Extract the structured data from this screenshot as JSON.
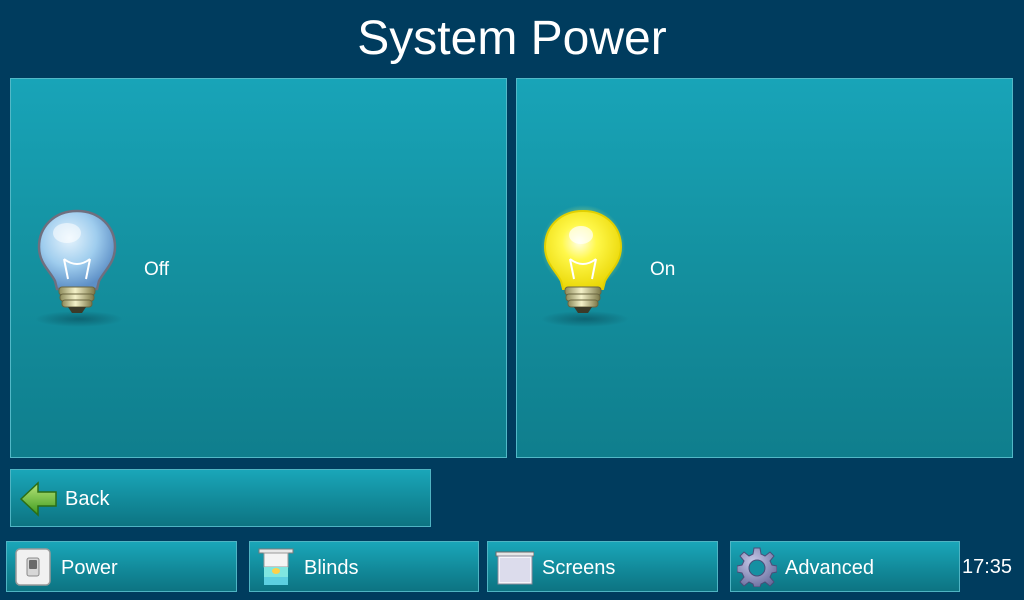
{
  "header": {
    "title": "System Power"
  },
  "panels": [
    {
      "label": "Off",
      "icon": "lightbulb-off-icon",
      "state": "off"
    },
    {
      "label": "On",
      "icon": "lightbulb-on-icon",
      "state": "on"
    }
  ],
  "back": {
    "label": "Back",
    "icon": "back-arrow-icon"
  },
  "nav": {
    "items": [
      {
        "label": "Power",
        "icon": "power-switch-icon"
      },
      {
        "label": "Blinds",
        "icon": "blinds-icon"
      },
      {
        "label": "Screens",
        "icon": "projector-screen-icon"
      },
      {
        "label": "Advanced",
        "icon": "gear-icon"
      }
    ]
  },
  "status": {
    "time": "17:35"
  },
  "colors": {
    "background": "#003c5e",
    "panel": "#1597a8",
    "bulb_on": "#ffe800",
    "bulb_off": "#9fd0ef",
    "arrow": "#4caf2a"
  }
}
